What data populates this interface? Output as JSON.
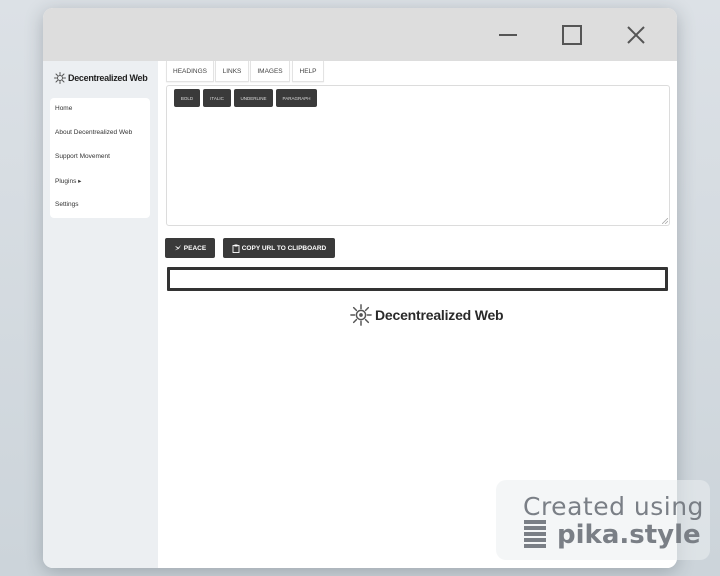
{
  "app": {
    "brand_name": "Decentrealized Web"
  },
  "sidebar": {
    "items": [
      {
        "label": "Home"
      },
      {
        "label": "About Decentrealized Web"
      },
      {
        "label": "Support Movement"
      },
      {
        "label": "Plugins ▸"
      },
      {
        "label": "Settings"
      }
    ]
  },
  "tabs": [
    {
      "label": "HEADINGS"
    },
    {
      "label": "LINKS"
    },
    {
      "label": "IMAGES"
    },
    {
      "label": "HELP"
    }
  ],
  "formatting": {
    "buttons": [
      {
        "label": "BOLD"
      },
      {
        "label": "ITALIC"
      },
      {
        "label": "UNDERLINE"
      },
      {
        "label": "PARAGRAPH"
      }
    ]
  },
  "actions": {
    "peace_label": "PEACE",
    "copy_label": "COPY URL TO CLIPBOARD"
  },
  "url_field": {
    "value": ""
  },
  "watermark": {
    "line1": "Created using",
    "line2": "pika.style"
  },
  "icons": {
    "minimize": "minimize-icon",
    "maximize": "maximize-icon",
    "close": "close-icon",
    "logo": "sun-logo-icon",
    "peace": "peace-dove-icon",
    "clipboard": "clipboard-icon"
  }
}
